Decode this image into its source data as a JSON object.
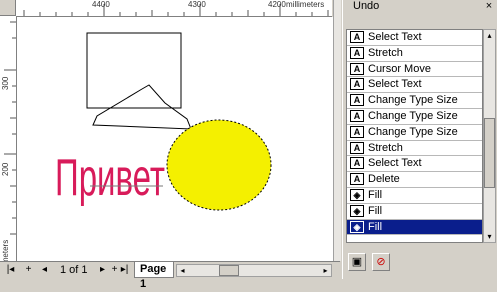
{
  "rulers": {
    "top_ticks": [
      "4400",
      "4300",
      "4200"
    ],
    "units_label": "millimeters",
    "left_ticks": [
      "300",
      "200"
    ],
    "left_units_label": "millimeters"
  },
  "drawing": {
    "text_object": "Привет",
    "text_color": "#d81b5a",
    "ellipse_fill": "#f4f000"
  },
  "page_nav": {
    "first": "|◂",
    "prev": "◂",
    "page_count": "1 of 1",
    "next": "▸",
    "last": "▸|",
    "tab_label": "Page 1"
  },
  "undo_panel": {
    "title": "Undo",
    "close_label": "×",
    "items": [
      {
        "label": "Select Text",
        "icon": "text-tool-icon",
        "glyph": "A"
      },
      {
        "label": "Stretch",
        "icon": "text-tool-icon",
        "glyph": "A"
      },
      {
        "label": "Cursor Move",
        "icon": "text-tool-icon",
        "glyph": "A"
      },
      {
        "label": "Select Text",
        "icon": "text-tool-icon",
        "glyph": "A"
      },
      {
        "label": "Change Type Size",
        "icon": "text-tool-icon",
        "glyph": "A"
      },
      {
        "label": "Change Type Size",
        "icon": "text-tool-icon",
        "glyph": "A"
      },
      {
        "label": "Change Type Size",
        "icon": "text-tool-icon",
        "glyph": "A"
      },
      {
        "label": "Stretch",
        "icon": "text-tool-icon",
        "glyph": "A"
      },
      {
        "label": "Select Text",
        "icon": "text-tool-icon",
        "glyph": "A"
      },
      {
        "label": "Delete",
        "icon": "text-tool-icon",
        "glyph": "A"
      },
      {
        "label": "Fill",
        "icon": "fill-bucket-icon",
        "glyph": "◈"
      },
      {
        "label": "Fill",
        "icon": "fill-bucket-icon",
        "glyph": "◈"
      },
      {
        "label": "Fill",
        "icon": "fill-bucket-icon",
        "glyph": "◈",
        "selected": true
      }
    ],
    "footer": {
      "save_glyph": "▣",
      "clear_glyph": "⊘"
    }
  }
}
